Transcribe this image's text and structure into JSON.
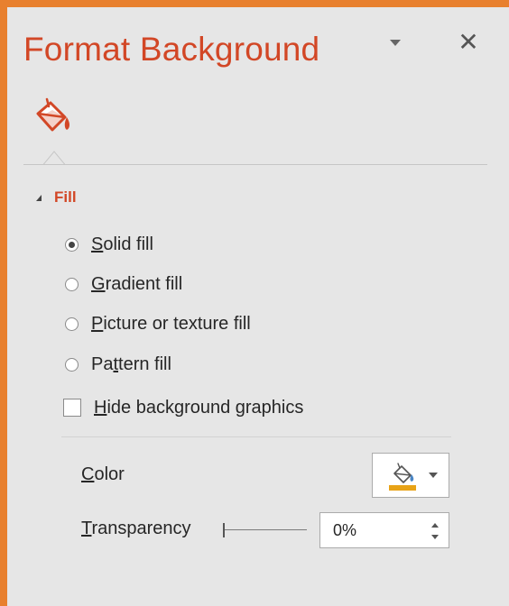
{
  "panel": {
    "title": "Format Background",
    "options_icon": "chevron-down-icon",
    "close_icon": "close-icon",
    "close_glyph": "✕"
  },
  "tabs": [
    {
      "name": "fill",
      "icon": "paint-bucket-icon",
      "selected": true
    }
  ],
  "fill_section": {
    "label": "Fill",
    "expanded": true,
    "options": [
      {
        "access_key": "S",
        "rest": "olid fill",
        "checked": true
      },
      {
        "access_key": "G",
        "rest": "radient fill",
        "checked": false
      },
      {
        "access_key": "P",
        "rest": "icture or texture fill",
        "checked": false
      },
      {
        "pre": "Pa",
        "access_key": "t",
        "rest": "tern fill",
        "checked": false
      }
    ],
    "hide_graphics": {
      "access_key": "H",
      "rest": "ide background graphics",
      "checked": false
    },
    "color": {
      "access_key": "C",
      "rest": "olor",
      "swatch_color": "#e8a317"
    },
    "transparency": {
      "access_key": "T",
      "rest": "ransparency",
      "value": "0%",
      "level": 0
    }
  },
  "colors": {
    "accent": "#d24726",
    "border": "#e8802e",
    "panel_bg": "#e6e6e6"
  }
}
